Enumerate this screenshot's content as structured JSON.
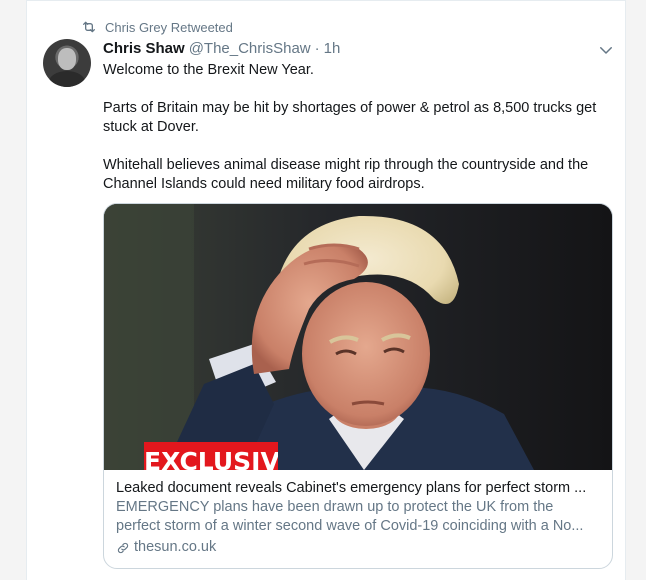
{
  "retweet": {
    "label": "Chris Grey Retweeted"
  },
  "tweet": {
    "author_name": "Chris Shaw",
    "author_handle": "@The_ChrisShaw",
    "separator": "·",
    "time": "1h",
    "paragraphs": [
      "Welcome to the Brexit New Year.",
      "Parts of Britain may be hit by shortages of power & petrol as 8,500 trucks get stuck at Dover.",
      "Whitehall believes animal disease might rip through the countryside and the Channel Islands could need military food airdrops."
    ]
  },
  "link_card": {
    "image_label": "EXCLUSIVE",
    "title": "Leaked document reveals Cabinet's emergency plans for perfect storm ...",
    "description": "EMERGENCY plans have been drawn up to protect the UK from the perfect storm of a winter second wave of Covid-19 coinciding with a No...",
    "domain": "thesun.co.uk"
  },
  "icons": {
    "retweet": "retweet-icon",
    "menu": "chevron-down-icon",
    "link": "link-icon"
  },
  "colors": {
    "text_primary": "#14171a",
    "text_secondary": "#657786",
    "border": "#ccd6dd",
    "exclusive_red": "#e3171d"
  }
}
